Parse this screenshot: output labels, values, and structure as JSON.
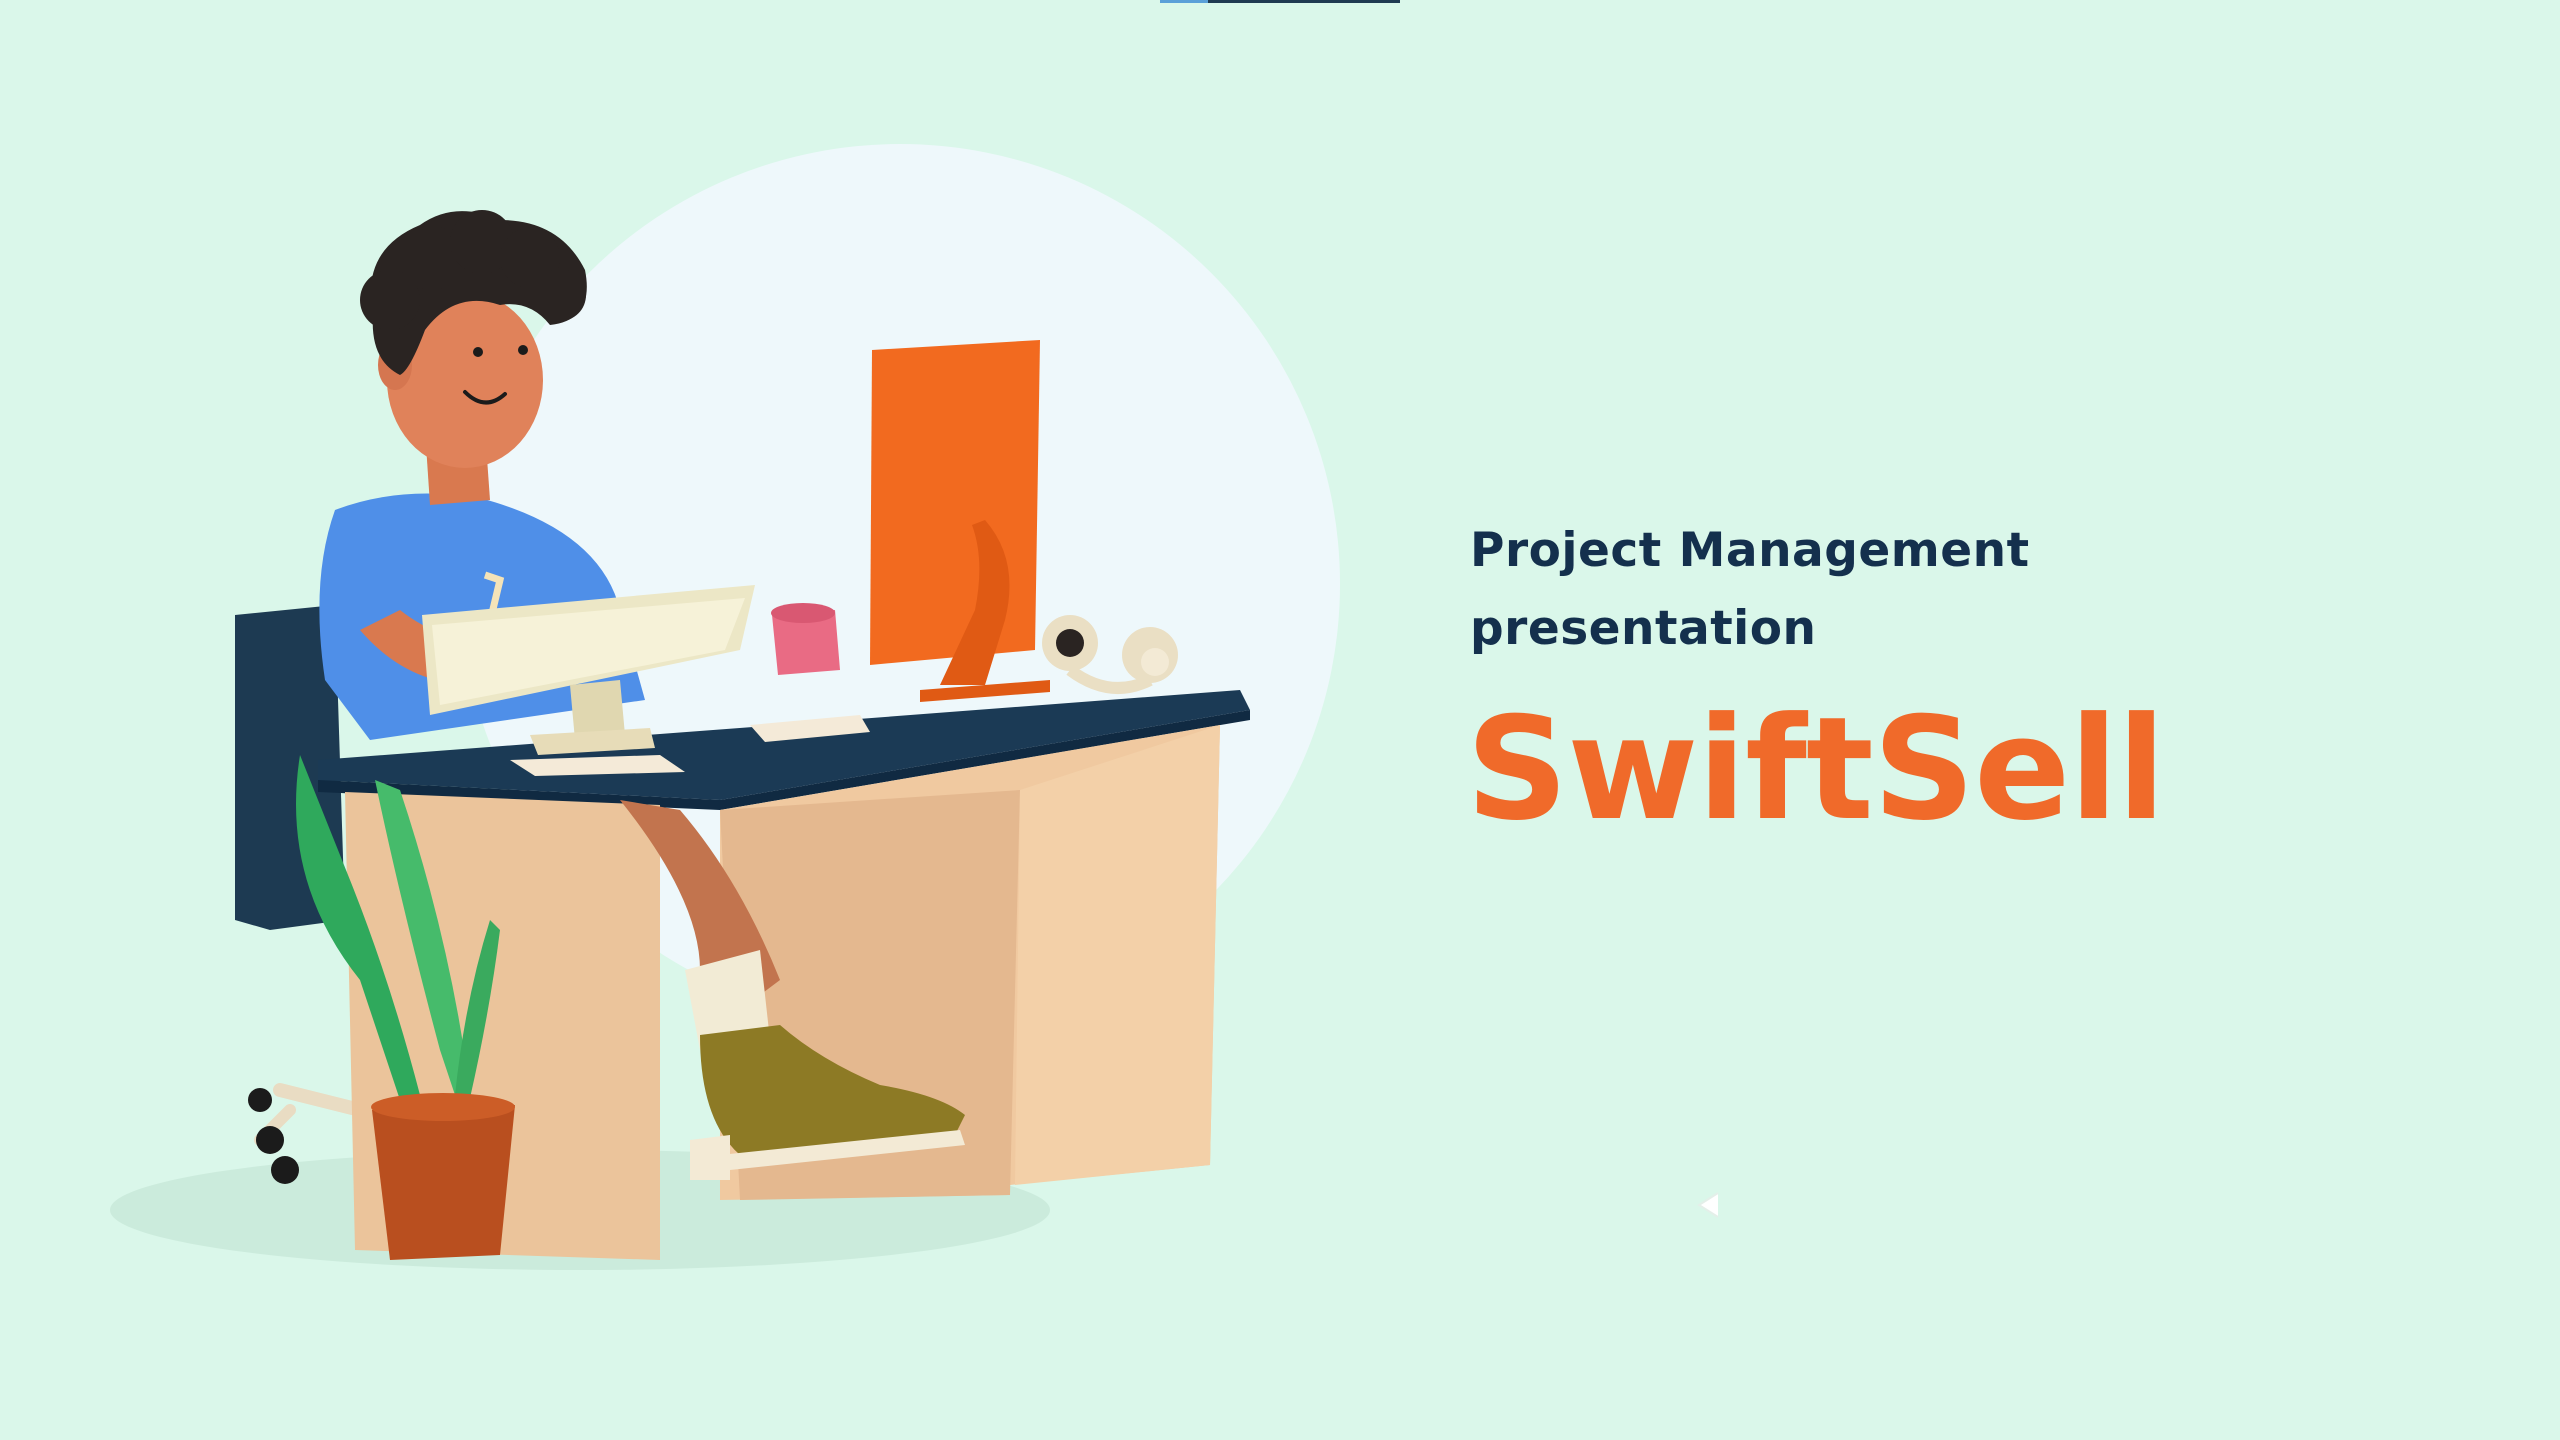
{
  "slide": {
    "subtitle_line1": "Project Management",
    "subtitle_line2": "presentation",
    "title": "SwiftSell"
  },
  "colors": {
    "background": "#daf7ea",
    "circle": "#eef8fb",
    "subtitle": "#14304d",
    "title": "#f06a2a"
  },
  "icons": {
    "nav": "previous-arrow-icon",
    "illustration": "person-at-desk-illustration"
  },
  "progress": {
    "fraction": 0.2
  }
}
